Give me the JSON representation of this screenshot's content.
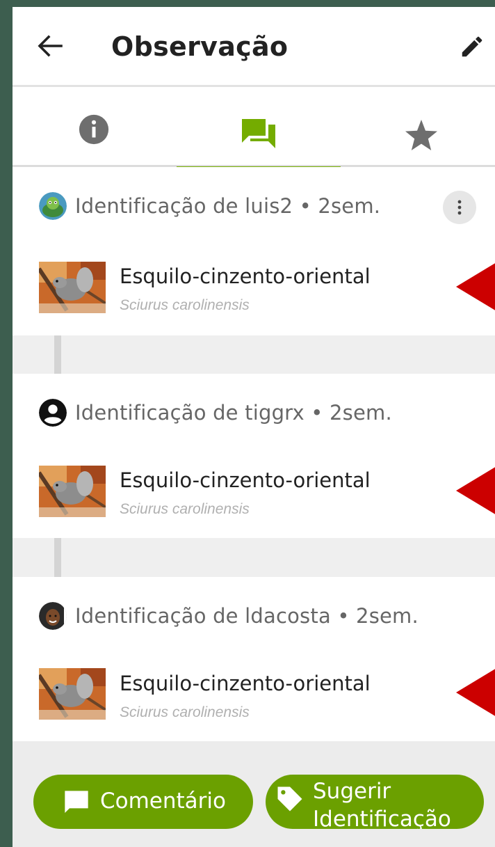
{
  "app_bar": {
    "title": "Observação",
    "back_icon": "arrow-left-icon",
    "edit_icon": "pencil-icon"
  },
  "tabs": [
    {
      "name": "info",
      "icon": "info-circle-icon",
      "active": false
    },
    {
      "name": "activity",
      "icon": "forum-icon",
      "active": true
    },
    {
      "name": "favorites",
      "icon": "star-icon",
      "active": false
    }
  ],
  "identifications": [
    {
      "header": "Identificação de luis2 • 2sem.",
      "common_name": "Esquilo-cinzento-oriental",
      "scientific_name": "Sciurus carolinensis",
      "has_menu": true
    },
    {
      "header": "Identificação de tiggrx • 2sem.",
      "common_name": "Esquilo-cinzento-oriental",
      "scientific_name": "Sciurus carolinensis",
      "has_menu": false
    },
    {
      "header": "Identificação de ldacosta • 2sem.",
      "common_name": "Esquilo-cinzento-oriental",
      "scientific_name": "Sciurus carolinensis",
      "has_menu": false
    }
  ],
  "actions": {
    "comment_label": "Comentário",
    "suggest_label": "Sugerir",
    "suggest_label_cut": "Identificação"
  },
  "colors": {
    "accent_green": "#74ac00",
    "button_green": "#6ba000",
    "arrow_red": "#cc0000",
    "outer_bg": "#3d5e4f"
  }
}
